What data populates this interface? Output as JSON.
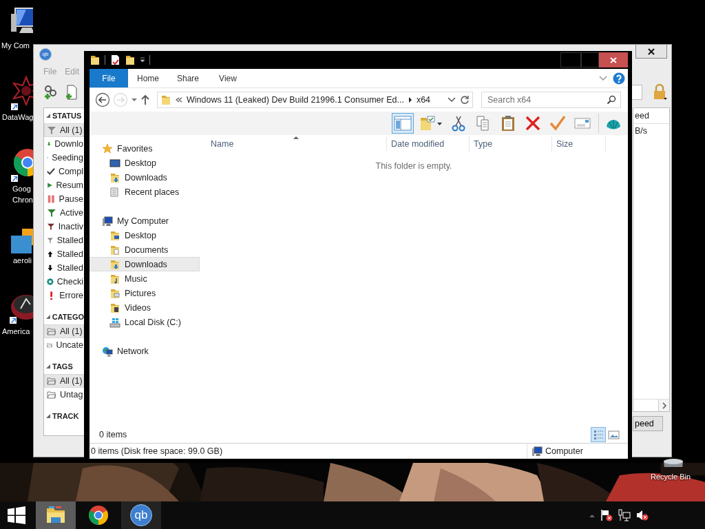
{
  "desktop": {
    "icons": [
      {
        "label": "My Com"
      },
      {
        "label": "DataWag"
      },
      {
        "label": "Goog Chron"
      },
      {
        "label": "aeroli"
      },
      {
        "label": "America"
      },
      {
        "label": "Recycle Bin"
      }
    ]
  },
  "qbittorrent": {
    "icon_text": "qb",
    "menu": [
      "File",
      "Edit"
    ],
    "sidebar": [
      {
        "title": "STATUS",
        "expanded": true,
        "items": [
          {
            "label": "All (1)",
            "selected": true
          },
          {
            "label": "Downlo",
            "selected": false
          },
          {
            "label": "Seeding",
            "selected": false
          },
          {
            "label": "Compl",
            "selected": false
          },
          {
            "label": "Resum",
            "selected": false
          },
          {
            "label": "Pause",
            "selected": false
          },
          {
            "label": "Active",
            "selected": false
          },
          {
            "label": "Inactiv",
            "selected": false
          },
          {
            "label": "Stalled",
            "selected": false
          },
          {
            "label": "Stalled",
            "selected": false
          },
          {
            "label": "Stalled",
            "selected": false
          },
          {
            "label": "Checki",
            "selected": false
          },
          {
            "label": "Errore",
            "selected": false
          }
        ]
      },
      {
        "title": "CATEGO",
        "expanded": true,
        "items": [
          {
            "label": "All (1)",
            "selected": true
          },
          {
            "label": "Uncate",
            "selected": false
          }
        ]
      },
      {
        "title": "TAGS",
        "expanded": true,
        "items": [
          {
            "label": "All (1)",
            "selected": true
          },
          {
            "label": "Untag",
            "selected": false
          }
        ]
      },
      {
        "title": "TRACK",
        "expanded": true
      }
    ],
    "transfer_list": {
      "column_header": "eed",
      "cell": "B/s"
    },
    "speed_button": "peed"
  },
  "explorer": {
    "ribbon_tabs": [
      {
        "label": "File",
        "kind": "menu"
      },
      {
        "label": "Home",
        "kind": "tab"
      },
      {
        "label": "Share",
        "kind": "tab"
      },
      {
        "label": "View",
        "kind": "tab"
      }
    ],
    "address": {
      "path": "Windows 11 (Leaked) Dev Build 21996.1 Consumer Ed...",
      "folder": "x64"
    },
    "search": {
      "placeholder": "Search x64"
    },
    "toolbar": [
      {
        "selected": true
      },
      {
        "selected": false
      },
      {
        "selected": false
      },
      {
        "selected": false
      },
      {
        "selected": false
      },
      {
        "selected": false
      },
      {
        "selected": false
      },
      {
        "selected": false
      },
      {
        "selected": false
      }
    ],
    "navigation": [
      {
        "label": "Favorites",
        "selected": false,
        "children": [
          {
            "label": "Desktop",
            "selected": false
          },
          {
            "label": "Downloads",
            "selected": false
          },
          {
            "label": "Recent places",
            "selected": false
          }
        ]
      },
      {
        "label": "My Computer",
        "selected": false,
        "children": [
          {
            "label": "Desktop",
            "selected": false
          },
          {
            "label": "Documents",
            "selected": false
          },
          {
            "label": "Downloads",
            "selected": true
          },
          {
            "label": "Music",
            "selected": false
          },
          {
            "label": "Pictures",
            "selected": false
          },
          {
            "label": "Videos",
            "selected": false
          },
          {
            "label": "Local Disk (C:)",
            "selected": false
          }
        ]
      },
      {
        "label": "Network",
        "selected": false
      }
    ],
    "columns": [
      {
        "label": "Name",
        "sorted": true
      },
      {
        "label": "Date modified",
        "sorted": false
      },
      {
        "label": "Type",
        "sorted": false
      },
      {
        "label": "Size",
        "sorted": false
      }
    ],
    "empty_message": "This folder is empty.",
    "item_count": "0 items",
    "view_buttons": [
      {
        "selected": true
      },
      {
        "selected": false
      }
    ],
    "status_bar": {
      "text": "0 items (Disk free space: 99.0 GB)",
      "location": "Computer"
    }
  },
  "taskbar": {
    "apps": [
      {
        "selected": true,
        "open": true
      },
      {
        "selected": false,
        "open": false
      },
      {
        "selected": false,
        "open": true,
        "icon_text": "qb"
      }
    ]
  }
}
